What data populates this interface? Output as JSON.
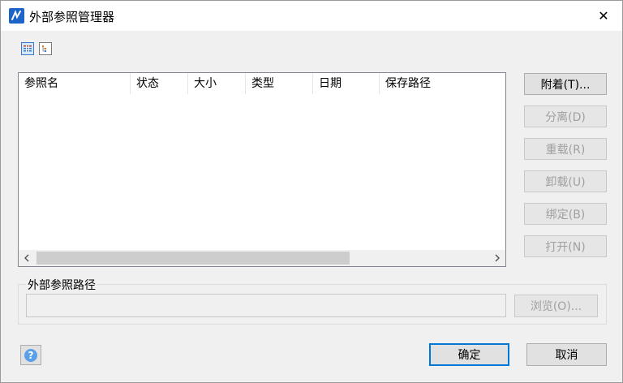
{
  "window": {
    "title": "外部参照管理器",
    "close_glyph": "✕"
  },
  "toolbar": {
    "list_view_icon": "list-view-icon",
    "tree_view_icon": "tree-view-icon"
  },
  "table": {
    "columns": [
      "参照名",
      "状态",
      "大小",
      "类型",
      "日期",
      "保存路径"
    ],
    "rows": []
  },
  "buttons": {
    "attach": "附着(T)...",
    "detach": "分离(D)",
    "reload": "重载(R)",
    "unload": "卸载(U)",
    "bind": "绑定(B)",
    "open": "打开(N)",
    "browse": "浏览(O)...",
    "ok": "确定",
    "cancel": "取消"
  },
  "xref_path": {
    "label": "外部参照路径",
    "value": ""
  },
  "colors": {
    "accent": "#0078d7",
    "app_icon": "#1d64c8",
    "help": "#5aa0e6"
  }
}
